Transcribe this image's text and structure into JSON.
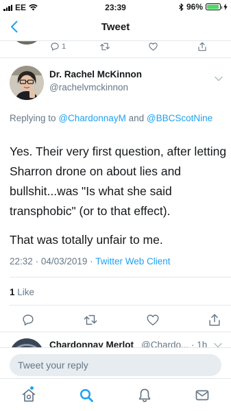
{
  "status_bar": {
    "carrier": "EE",
    "time": "23:39",
    "battery": "96%",
    "battery_level": 0.96
  },
  "nav": {
    "title": "Tweet"
  },
  "previous_tweet": {
    "reply_count": "1"
  },
  "tweet": {
    "display_name": "Dr. Rachel McKinnon",
    "handle": "@rachelvmckinnon",
    "replying_prefix": "Replying to",
    "mention_1": "@ChardonnayM",
    "replying_and": "and",
    "mention_2": "@BBCScotNine",
    "text_p1": "Yes. Their very first question, after letting Sharron drone on about lies and bullshit...was \"Is what she said transphobic\" (or to that effect).",
    "text_p2": "That was totally unfair to me.",
    "time": "22:32",
    "date": "04/03/2019",
    "separator": "·",
    "client": "Twitter Web Client",
    "likes_count": "1",
    "likes_label": "Like"
  },
  "next_tweet": {
    "display_name": "Chardonnay Merlot",
    "handle": "@Chardo...",
    "separator": "·",
    "age": "1h"
  },
  "reply": {
    "placeholder": "Tweet your reply"
  },
  "colors": {
    "accent": "#1da1f2",
    "text": "#14171a",
    "secondary": "#657786",
    "divider": "#e1e8ed",
    "battery": "#4cd964"
  },
  "tabs": [
    {
      "name": "home",
      "icon": "home-icon"
    },
    {
      "name": "search",
      "icon": "search-icon",
      "active": true
    },
    {
      "name": "notifications",
      "icon": "bell-icon"
    },
    {
      "name": "messages",
      "icon": "mail-icon"
    }
  ]
}
